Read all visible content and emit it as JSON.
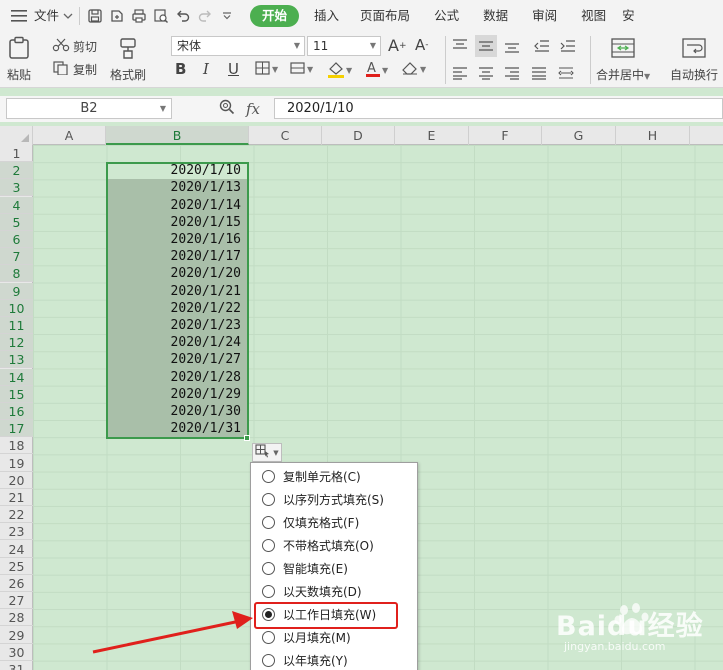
{
  "menubar": {
    "file_label": "文件",
    "tabs": [
      "开始",
      "插入",
      "页面布局",
      "公式",
      "数据",
      "审阅",
      "视图",
      "安"
    ]
  },
  "toolbar": {
    "paste": "粘贴",
    "cut": "剪切",
    "copy": "复制",
    "format_painter": "格式刷",
    "font_name": "宋体",
    "font_size": "11",
    "merge_center": "合并居中",
    "auto_wrap": "自动换行",
    "bold": "B",
    "italic": "I",
    "underline": "U"
  },
  "formula_bar": {
    "name_box": "B2",
    "fx": "fx",
    "formula": "2020/1/10"
  },
  "sheet": {
    "columns": [
      "A",
      "B",
      "C",
      "D",
      "E",
      "F",
      "G",
      "H"
    ],
    "rows": [
      "1",
      "2",
      "3",
      "4",
      "5",
      "6",
      "7",
      "8",
      "9",
      "10",
      "11",
      "12",
      "13",
      "14",
      "15",
      "16",
      "17",
      "18",
      "19",
      "20",
      "21",
      "22",
      "23",
      "24",
      "25",
      "26",
      "27",
      "28",
      "29",
      "30",
      "31"
    ],
    "column_b_values": [
      "2020/1/10",
      "2020/1/13",
      "2020/1/14",
      "2020/1/15",
      "2020/1/16",
      "2020/1/17",
      "2020/1/20",
      "2020/1/21",
      "2020/1/22",
      "2020/1/23",
      "2020/1/24",
      "2020/1/27",
      "2020/1/28",
      "2020/1/29",
      "2020/1/30",
      "2020/1/31"
    ]
  },
  "autofill_menu": {
    "options": [
      {
        "label": "复制单元格(C)",
        "checked": false
      },
      {
        "label": "以序列方式填充(S)",
        "checked": false
      },
      {
        "label": "仅填充格式(F)",
        "checked": false
      },
      {
        "label": "不带格式填充(O)",
        "checked": false
      },
      {
        "label": "智能填充(E)",
        "checked": false
      },
      {
        "label": "以天数填充(D)",
        "checked": false
      },
      {
        "label": "以工作日填充(W)",
        "checked": true
      },
      {
        "label": "以月填充(M)",
        "checked": false
      },
      {
        "label": "以年填充(Y)",
        "checked": false
      }
    ]
  },
  "watermark": {
    "text": "Baidu经验",
    "url": "jingyan.baidu.com"
  },
  "colors": {
    "accent": "#4caf50",
    "selection_border": "#3c9a4c",
    "highlight": "#e0201c",
    "sheet_bg": "#cfe8d0"
  }
}
